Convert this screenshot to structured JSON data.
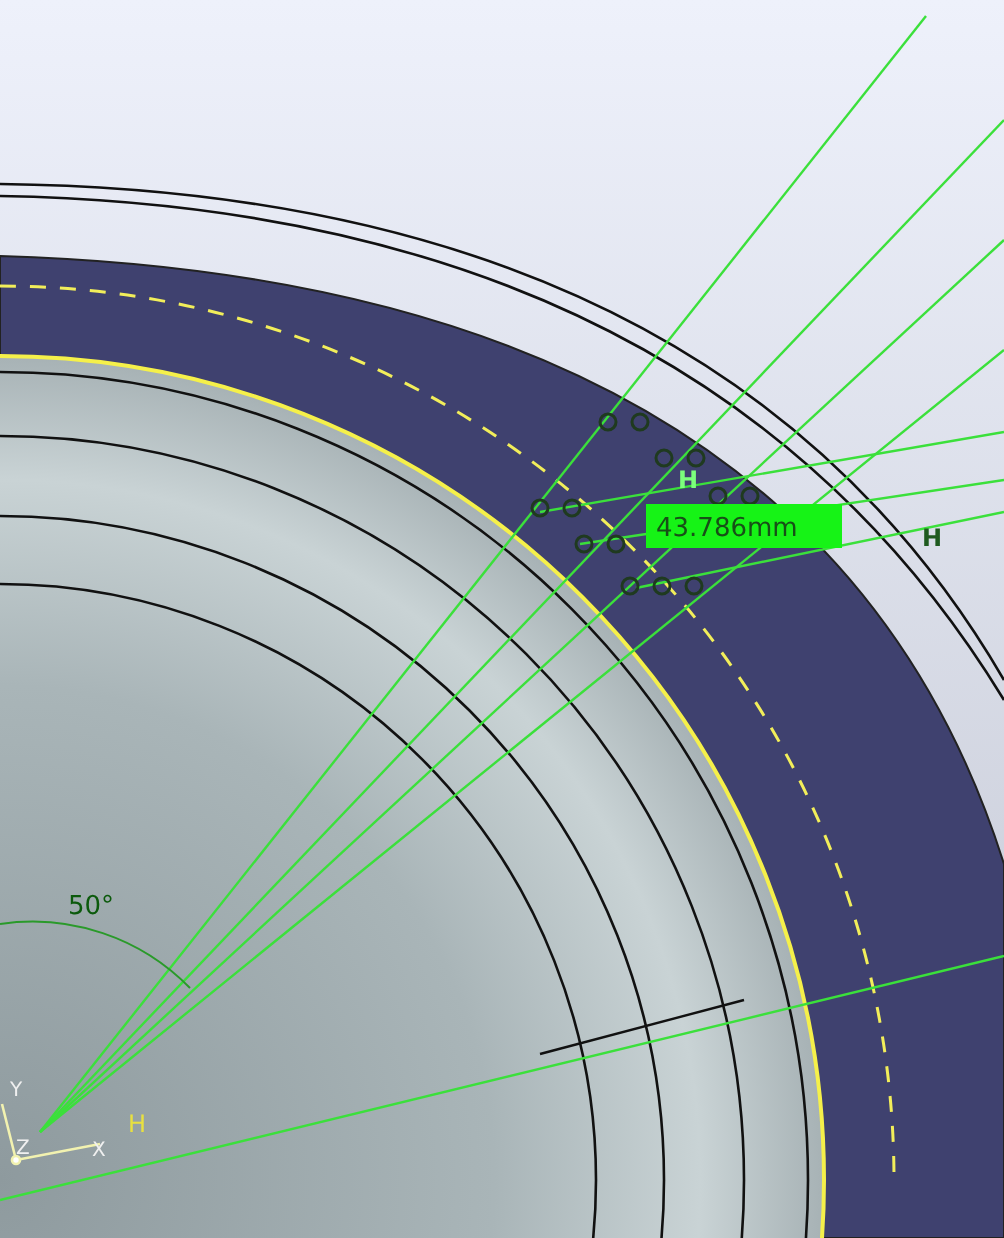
{
  "dimension": {
    "value": "43.786mm"
  },
  "angle_dimension": {
    "value": "50°"
  },
  "constraint_labels": [
    "H",
    "H"
  ],
  "axis": {
    "h_label": "H",
    "x": "X",
    "y": "Y",
    "z": "Z"
  }
}
